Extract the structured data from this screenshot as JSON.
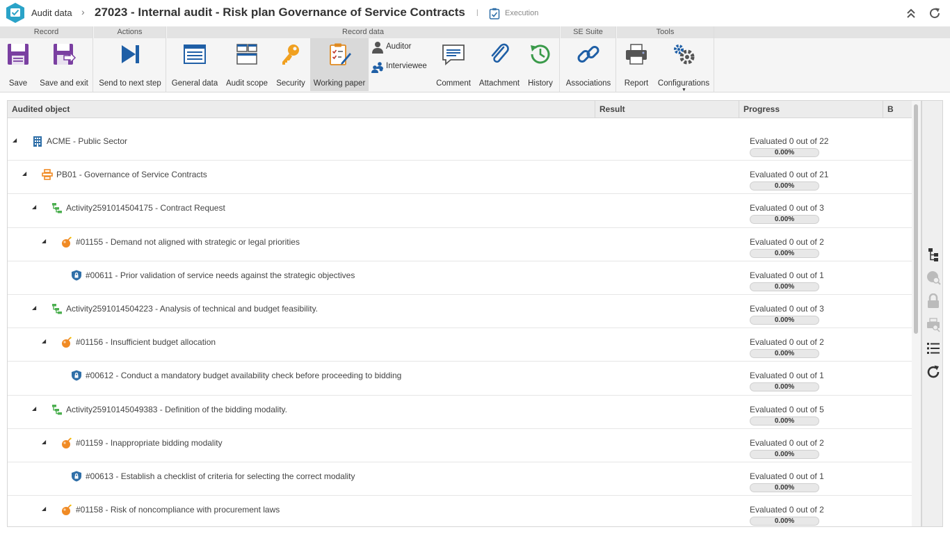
{
  "header": {
    "app_title": "Audit data",
    "separator": "›",
    "record_title": "27023 - Internal audit - Risk plan Governance of Service Contracts",
    "divider": "|",
    "status": "Execution"
  },
  "ribbon": {
    "groups": {
      "record": "Record",
      "actions": "Actions",
      "record_data": "Record data",
      "se_suite": "SE Suite",
      "tools": "Tools"
    },
    "buttons": {
      "save": "Save",
      "save_exit": "Save and exit",
      "send_next": "Send to next step",
      "general_data": "General data",
      "audit_scope": "Audit scope",
      "security": "Security",
      "working_paper": "Working paper",
      "auditor": "Auditor",
      "interviewee": "Interviewee",
      "comment": "Comment",
      "attachment": "Attachment",
      "history": "History",
      "associations": "Associations",
      "report": "Report",
      "configurations": "Configurations"
    }
  },
  "grid": {
    "columns": {
      "object": "Audited object",
      "result": "Result",
      "progress": "Progress",
      "b": "B"
    },
    "rows": [
      {
        "level": 0,
        "type": "building",
        "label": "ACME - Public Sector",
        "progress_text": "Evaluated 0 out of 22",
        "percent": "0.00%",
        "fraction": 0
      },
      {
        "level": 1,
        "type": "process",
        "label": "PB01 - Governance of Service Contracts",
        "progress_text": "Evaluated 0 out of 21",
        "percent": "0.00%",
        "fraction": 0
      },
      {
        "level": 2,
        "type": "activity",
        "label": "Activity2591014504175 - Contract Request",
        "progress_text": "Evaluated 0 out of 3",
        "percent": "0.00%",
        "fraction": 0
      },
      {
        "level": 3,
        "type": "risk",
        "label": "#01155 - Demand not aligned with strategic or legal priorities",
        "progress_text": "Evaluated 0 out of 2",
        "percent": "0.00%",
        "fraction": 0
      },
      {
        "level": 4,
        "type": "control",
        "label": "#00611 - Prior validation of service needs against the strategic objectives",
        "progress_text": "Evaluated 0 out of 1",
        "percent": "0.00%",
        "fraction": 0
      },
      {
        "level": 2,
        "type": "activity",
        "label": "Activity2591014504223 - Analysis of technical and budget feasibility.",
        "progress_text": "Evaluated 0 out of 3",
        "percent": "0.00%",
        "fraction": 0
      },
      {
        "level": 3,
        "type": "risk",
        "label": "#01156 - Insufficient budget allocation",
        "progress_text": "Evaluated 0 out of 2",
        "percent": "0.00%",
        "fraction": 0
      },
      {
        "level": 4,
        "type": "control",
        "label": "#00612 - Conduct a mandatory budget availability check before proceeding to bidding",
        "progress_text": "Evaluated 0 out of 1",
        "percent": "0.00%",
        "fraction": 0
      },
      {
        "level": 2,
        "type": "activity",
        "label": "Activity2591014504938​3 - Definition of the bidding modality.",
        "progress_text": "Evaluated 0 out of 5",
        "percent": "0.00%",
        "fraction": 0
      },
      {
        "level": 3,
        "type": "risk",
        "label": "#01159 - Inappropriate bidding modality",
        "progress_text": "Evaluated 0 out of 2",
        "percent": "0.00%",
        "fraction": 0
      },
      {
        "level": 4,
        "type": "control",
        "label": "#00613 - Establish a checklist of criteria for selecting the correct modality",
        "progress_text": "Evaluated 0 out of 1",
        "percent": "0.00%",
        "fraction": 0
      },
      {
        "level": 3,
        "type": "risk",
        "label": "#01158 - Risk of noncompliance with procurement laws",
        "progress_text": "Evaluated 0 out of 2",
        "percent": "0.00%",
        "fraction": 0
      }
    ]
  },
  "colors": {
    "brand": "#2aa3c8",
    "save_purple": "#7a3fa1",
    "activity_green": "#4caf50",
    "risk_orange": "#f08a24",
    "control_blue": "#2f6fa8",
    "progress_fill": "#5ba85b"
  }
}
